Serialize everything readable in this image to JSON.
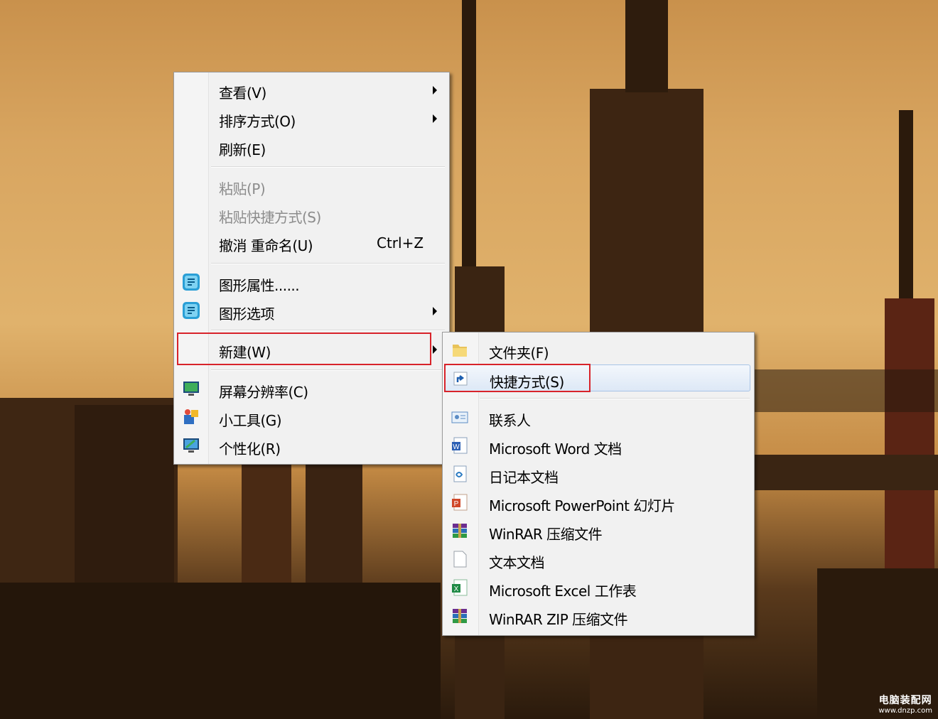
{
  "context_menu": {
    "items": [
      {
        "label": "查看(V)",
        "has_submenu": true
      },
      {
        "label": "排序方式(O)",
        "has_submenu": true
      },
      {
        "label": "刷新(E)"
      },
      {
        "label": "粘贴(P)",
        "disabled": true
      },
      {
        "label": "粘贴快捷方式(S)",
        "disabled": true
      },
      {
        "label": "撤消 重命名(U)",
        "shortcut": "Ctrl+Z"
      },
      {
        "label": "图形属性......",
        "icon": "graphics-properties-icon"
      },
      {
        "label": "图形选项",
        "icon": "graphics-options-icon",
        "has_submenu": true
      },
      {
        "label": "新建(W)",
        "has_submenu": true,
        "highlighted": true
      },
      {
        "label": "屏幕分辨率(C)",
        "icon": "screen-resolution-icon"
      },
      {
        "label": "小工具(G)",
        "icon": "gadgets-icon"
      },
      {
        "label": "个性化(R)",
        "icon": "personalize-icon"
      }
    ]
  },
  "new_submenu": {
    "items": [
      {
        "label": "文件夹(F)",
        "icon": "folder-icon"
      },
      {
        "label": "快捷方式(S)",
        "icon": "shortcut-icon",
        "highlighted": true
      },
      {
        "label": "联系人",
        "icon": "contact-icon"
      },
      {
        "label": "Microsoft Word 文档",
        "icon": "word-document-icon"
      },
      {
        "label": "日记本文档",
        "icon": "journal-document-icon"
      },
      {
        "label": "Microsoft PowerPoint 幻灯片",
        "icon": "powerpoint-icon"
      },
      {
        "label": "WinRAR 压缩文件",
        "icon": "winrar-icon"
      },
      {
        "label": "文本文档",
        "icon": "text-document-icon"
      },
      {
        "label": "Microsoft Excel 工作表",
        "icon": "excel-icon"
      },
      {
        "label": "WinRAR ZIP 压缩文件",
        "icon": "winrar-zip-icon"
      }
    ]
  },
  "highlight_color": "#d8232a",
  "watermark": {
    "line1": "电脑装配网",
    "line2": "www.dnzp.com"
  }
}
